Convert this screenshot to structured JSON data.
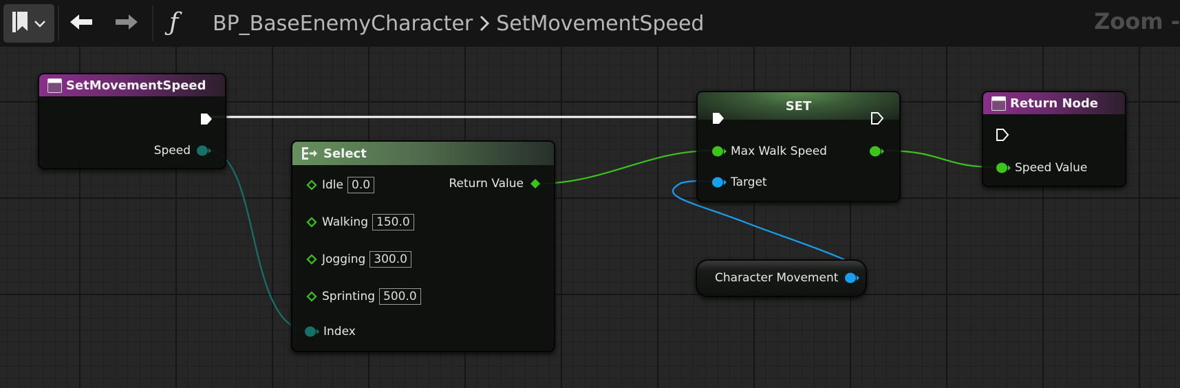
{
  "toolbar": {
    "fn_symbol": "ƒ",
    "breadcrumb_parent": "BP_BaseEnemyCharacter",
    "breadcrumb_current": "SetMovementSpeed",
    "zoom_label": "Zoom -"
  },
  "nodes": {
    "entry": {
      "title": "SetMovementSpeed",
      "speed_label": "Speed"
    },
    "select": {
      "title": "Select",
      "return_label": "Return Value",
      "options": [
        {
          "label": "Idle",
          "value": "0.0"
        },
        {
          "label": "Walking",
          "value": "150.0"
        },
        {
          "label": "Jogging",
          "value": "300.0"
        },
        {
          "label": "Sprinting",
          "value": "500.0"
        }
      ],
      "index_label": "Index"
    },
    "set": {
      "title": "SET",
      "max_walk_speed_label": "Max Walk Speed",
      "target_label": "Target"
    },
    "return": {
      "title": "Return Node",
      "speed_value_label": "Speed Value"
    },
    "char_movement": {
      "label": "Character Movement"
    }
  },
  "colors": {
    "exec": "#ffffff",
    "float_pin": "#3cc41a",
    "int_pin": "#177a6e",
    "object_pin": "#18a0f0",
    "function_header": "#8a2f8a",
    "select_header": "#66915e"
  }
}
